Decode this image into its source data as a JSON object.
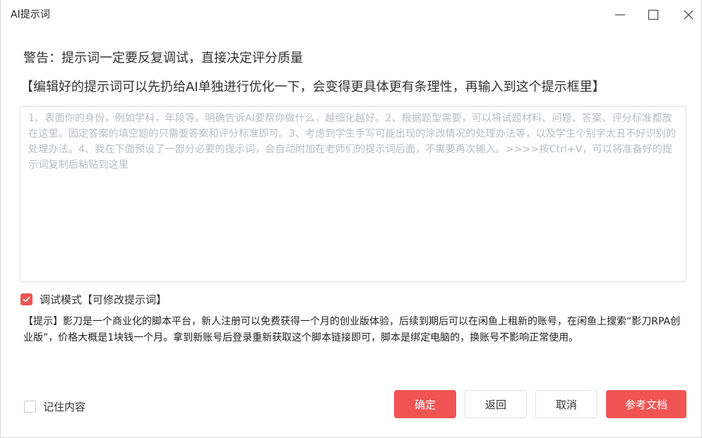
{
  "window": {
    "title": "AI提示词"
  },
  "warning": "警告：提示词一定要反复调试，直接决定评分质量",
  "tip": "【编辑好的提示词可以先扔给AI单独进行优化一下，会变得更具体更有条理性，再输入到这个提示框里】",
  "prompt_input": {
    "value": "",
    "placeholder": "1、表面你的身份，例如学科，年段等。明确告诉AI要帮你做什么，越细化越好。2、根据题型需要，可以将试题材料、问题、答案、评分标准都放在这里。固定答案的填空题的只需要答案和评分标准即可。3、考虑到学生手写可能出现的涂改情况的处理办法等，以及学生个别字太丑不好识别的处理办法。4、我在下面预设了一部分必要的提示词，会自动附加在老师们的提示词后面，不需要再次输入。>>>>按Ctrl+V，可以将准备好的提示词复制后粘贴到这里"
  },
  "debug_mode": {
    "label": "调试模式【可修改提示词】",
    "checked": true
  },
  "notice": "【提示】影刀是一个商业化的脚本平台，新人注册可以免费获得一个月的创业版体验，后续到期后可以在闲鱼上租新的账号，在闲鱼上搜索“影刀RPA创业版”，价格大概是1块钱一个月。拿到新账号后登录重新获取这个脚本链接即可，脚本是绑定电脑的，换账号不影响正常使用。",
  "remember": {
    "label": "记住内容",
    "checked": false
  },
  "buttons": {
    "ok": "确定",
    "back": "返回",
    "cancel": "取消",
    "docs": "参考文档"
  },
  "colors": {
    "accent": "#f05454",
    "placeholder": "#b8bcc4",
    "border": "#dcdfe6"
  },
  "icons": {
    "minimize": "minimize-icon",
    "maximize": "maximize-icon",
    "close": "close-icon",
    "check": "checkmark-icon"
  }
}
